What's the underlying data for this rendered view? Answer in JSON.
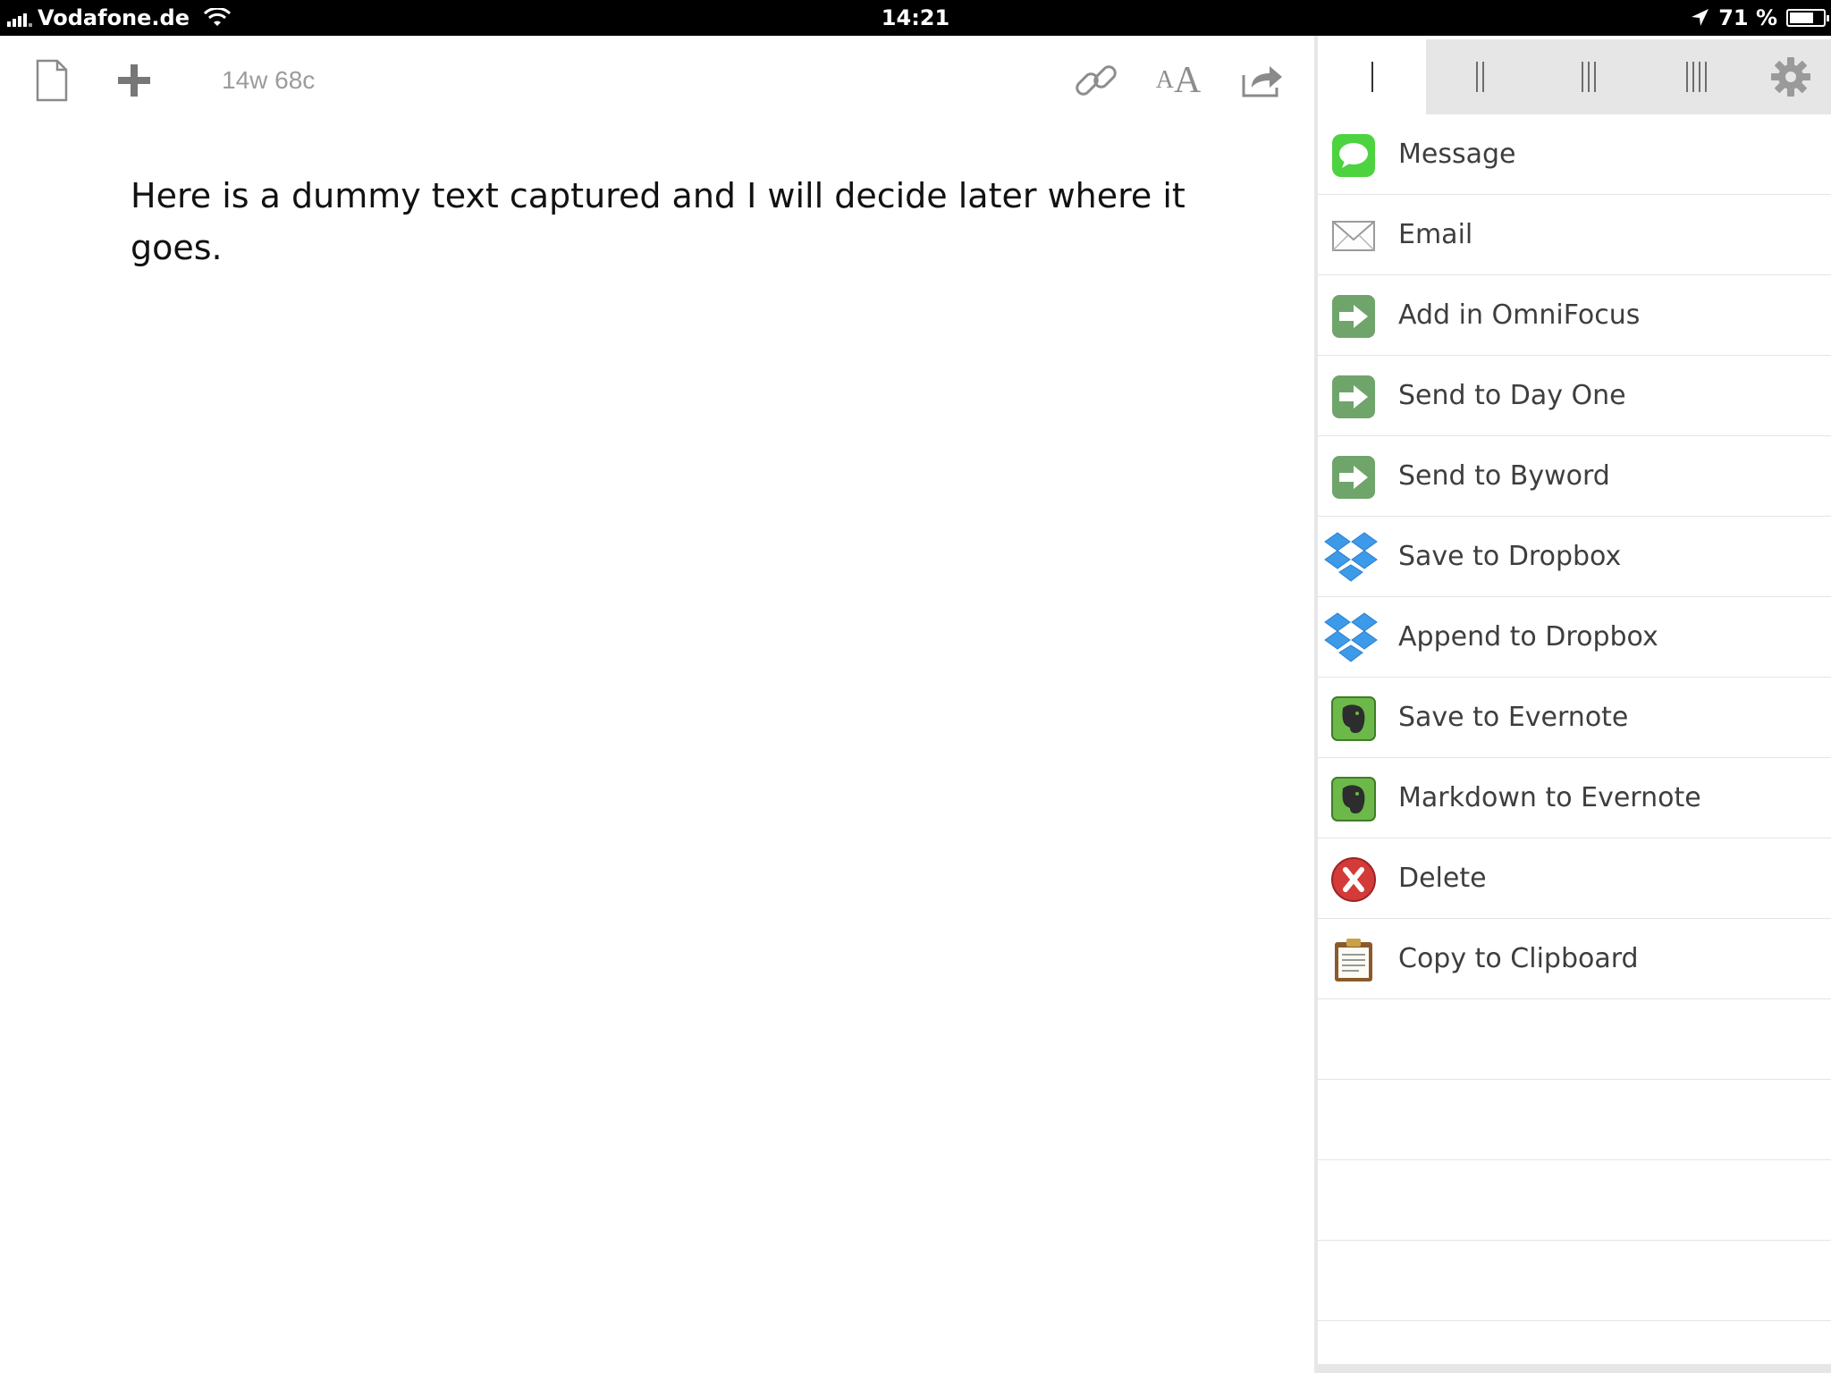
{
  "status_bar": {
    "carrier": "Vodafone.de",
    "time": "14:21",
    "battery": "71 %",
    "battery_level_percent": 71
  },
  "toolbar": {
    "word_count": "14w 68c",
    "font_button_small": "A",
    "font_button_big": "A"
  },
  "document": {
    "text": "Here is a dummy text captured and I will decide later where it goes."
  },
  "panel": {
    "tabs": [
      {
        "bars": 1,
        "active": true
      },
      {
        "bars": 2,
        "active": false
      },
      {
        "bars": 3,
        "active": false
      },
      {
        "bars": 4,
        "active": false
      }
    ],
    "actions": [
      {
        "label": "Message",
        "icon": "message-icon"
      },
      {
        "label": "Email",
        "icon": "envelope-icon"
      },
      {
        "label": "Add in OmniFocus",
        "icon": "arrow-right-icon"
      },
      {
        "label": "Send to Day One",
        "icon": "arrow-right-icon"
      },
      {
        "label": "Send to Byword",
        "icon": "arrow-right-icon"
      },
      {
        "label": "Save to Dropbox",
        "icon": "dropbox-icon"
      },
      {
        "label": "Append to Dropbox",
        "icon": "dropbox-icon"
      },
      {
        "label": "Save to Evernote",
        "icon": "evernote-icon"
      },
      {
        "label": "Markdown to Evernote",
        "icon": "evernote-icon"
      },
      {
        "label": "Delete",
        "icon": "delete-icon"
      },
      {
        "label": "Copy to Clipboard",
        "icon": "clipboard-icon"
      }
    ]
  },
  "colors": {
    "message_green": "#4cd33f",
    "action_green": "#6fa56a",
    "dropbox_blue": "#3d9ae8",
    "evernote_green": "#6cb94a",
    "delete_red": "#d33b3b",
    "clipboard_brown": "#8a5a2b"
  }
}
